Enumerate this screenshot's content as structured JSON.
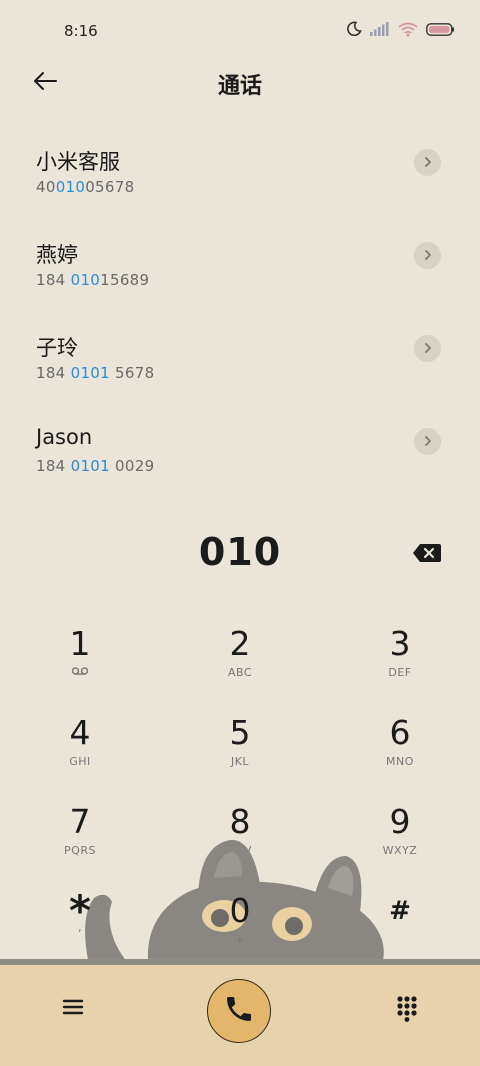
{
  "status": {
    "time": "8:16",
    "icons": [
      "moon-icon",
      "signal-icon",
      "wifi-icon",
      "battery-icon"
    ]
  },
  "header": {
    "title": "通话",
    "back_icon": "arrow-left-icon"
  },
  "contacts": [
    {
      "name": "小米客服",
      "number_pre": "40",
      "number_match": "010",
      "number_post": "05678"
    },
    {
      "name": "燕婷",
      "number_pre": "184 ",
      "number_match": "010",
      "number_post": "15689"
    },
    {
      "name": "子玲",
      "number_pre": "184 ",
      "number_match": "0101",
      "number_post": " 5678"
    },
    {
      "name": "Jason",
      "number_pre": "184 ",
      "number_match": "0101",
      "number_post": " 0029"
    }
  ],
  "dialer": {
    "number": "010",
    "backspace_icon": "backspace-icon"
  },
  "keypad": [
    {
      "digit": "1",
      "letters": "",
      "sub_icon": "voicemail-icon"
    },
    {
      "digit": "2",
      "letters": "ABC"
    },
    {
      "digit": "3",
      "letters": "DEF"
    },
    {
      "digit": "4",
      "letters": "GHI"
    },
    {
      "digit": "5",
      "letters": "JKL"
    },
    {
      "digit": "6",
      "letters": "MNO"
    },
    {
      "digit": "7",
      "letters": "PQRS"
    },
    {
      "digit": "8",
      "letters": "TUV"
    },
    {
      "digit": "9",
      "letters": "WXYZ"
    },
    {
      "digit": "*",
      "letters": ","
    },
    {
      "digit": "0",
      "letters": "+"
    },
    {
      "digit": "#",
      "letters": ""
    }
  ],
  "bottom_bar": {
    "menu_icon": "menu-icon",
    "call_icon": "phone-icon",
    "dialpad_icon": "dialpad-icon"
  },
  "colors": {
    "background": "#ebe5d9",
    "highlight": "#2a8be0",
    "call_button": "#e4b56d",
    "bottom_bar": "#e8d2ac"
  }
}
